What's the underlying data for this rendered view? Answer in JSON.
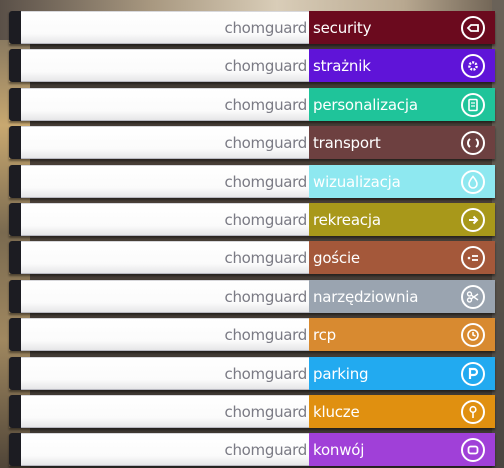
{
  "brand": "chomguard",
  "items": [
    {
      "label": "security",
      "color": "#6b0a1e",
      "icon": "security-icon"
    },
    {
      "label": "strażnik",
      "color": "#5f14d8",
      "icon": "gear-icon"
    },
    {
      "label": "personalizacja",
      "color": "#1fc49a",
      "icon": "document-icon"
    },
    {
      "label": "transport",
      "color": "#6d4040",
      "icon": "refresh-icon"
    },
    {
      "label": "wizualizacja",
      "color": "#8ee8f0",
      "icon": "drop-icon"
    },
    {
      "label": "rekreacja",
      "color": "#a8981a",
      "icon": "arrow-right-icon"
    },
    {
      "label": "goście",
      "color": "#a4583a",
      "icon": "list-icon"
    },
    {
      "label": "narzędziownia",
      "color": "#9aa4b0",
      "icon": "scissors-icon"
    },
    {
      "label": "rcp",
      "color": "#d88a30",
      "icon": "clock-icon"
    },
    {
      "label": "parking",
      "color": "#22aaf0",
      "icon": "parking-icon"
    },
    {
      "label": "klucze",
      "color": "#e09010",
      "icon": "key-icon"
    },
    {
      "label": "konwój",
      "color": "#a040d8",
      "icon": "convoy-icon"
    }
  ]
}
